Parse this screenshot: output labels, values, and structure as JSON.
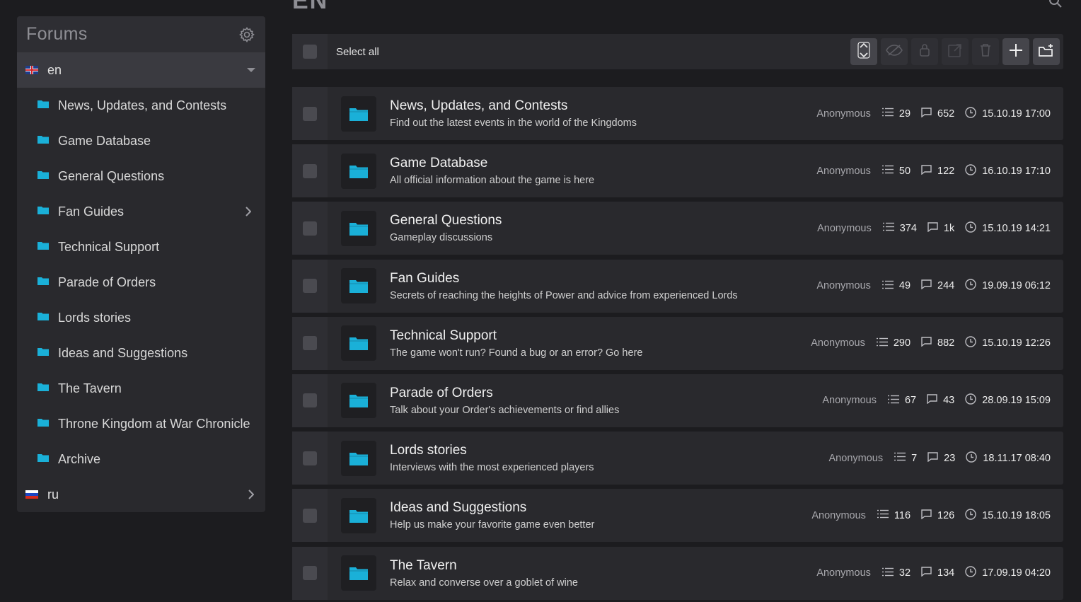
{
  "page": {
    "heading": "EN"
  },
  "colors": {
    "accent": "#1ab0d8",
    "panel": "#29292d",
    "background": "#1c1c1f"
  },
  "sidebar": {
    "title": "Forums",
    "languages": [
      {
        "code": "en",
        "label": "en",
        "expanded": true
      },
      {
        "code": "ru",
        "label": "ru",
        "expanded": false
      }
    ],
    "items": [
      {
        "label": "News, Updates, and Contests",
        "has_children": false
      },
      {
        "label": "Game Database",
        "has_children": false
      },
      {
        "label": "General Questions",
        "has_children": false
      },
      {
        "label": "Fan Guides",
        "has_children": true
      },
      {
        "label": "Technical Support",
        "has_children": false
      },
      {
        "label": "Parade of Orders",
        "has_children": false
      },
      {
        "label": "Lords stories",
        "has_children": false
      },
      {
        "label": "Ideas and Suggestions",
        "has_children": false
      },
      {
        "label": "The Tavern",
        "has_children": false
      },
      {
        "label": "Throne Kingdom at War Chronicle",
        "has_children": false
      },
      {
        "label": "Archive",
        "has_children": false
      }
    ]
  },
  "toolbar": {
    "select_all_label": "Select all",
    "buttons": [
      "sort-icon",
      "hide-icon",
      "lock-icon",
      "move-icon",
      "delete-icon",
      "add-icon",
      "new-folder-icon"
    ]
  },
  "forums": [
    {
      "title": "News, Updates, and Contests",
      "description": "Find out the latest events in the world of the Kingdoms",
      "author": "Anonymous",
      "topics": "29",
      "posts": "652",
      "last": "15.10.19 17:00"
    },
    {
      "title": "Game Database",
      "description": "All official information about the game is here",
      "author": "Anonymous",
      "topics": "50",
      "posts": "122",
      "last": "16.10.19 17:10"
    },
    {
      "title": "General Questions",
      "description": "Gameplay discussions",
      "author": "Anonymous",
      "topics": "374",
      "posts": "1k",
      "last": "15.10.19 14:21"
    },
    {
      "title": "Fan Guides",
      "description": "Secrets of reaching the heights of Power and advice from experienced Lords",
      "author": "Anonymous",
      "topics": "49",
      "posts": "244",
      "last": "19.09.19 06:12"
    },
    {
      "title": "Technical Support",
      "description": "The game won't run? Found a bug or an error? Go here",
      "author": "Anonymous",
      "topics": "290",
      "posts": "882",
      "last": "15.10.19 12:26"
    },
    {
      "title": "Parade of Orders",
      "description": "Talk about your Order's achievements or find allies",
      "author": "Anonymous",
      "topics": "67",
      "posts": "43",
      "last": "28.09.19 15:09"
    },
    {
      "title": "Lords stories",
      "description": "Interviews with the most experienced players",
      "author": "Anonymous",
      "topics": "7",
      "posts": "23",
      "last": "18.11.17 08:40"
    },
    {
      "title": "Ideas and Suggestions",
      "description": "Help us make your favorite game even better",
      "author": "Anonymous",
      "topics": "116",
      "posts": "126",
      "last": "15.10.19 18:05"
    },
    {
      "title": "The Tavern",
      "description": "Relax and converse over a goblet of wine",
      "author": "Anonymous",
      "topics": "32",
      "posts": "134",
      "last": "17.09.19 04:20"
    }
  ]
}
